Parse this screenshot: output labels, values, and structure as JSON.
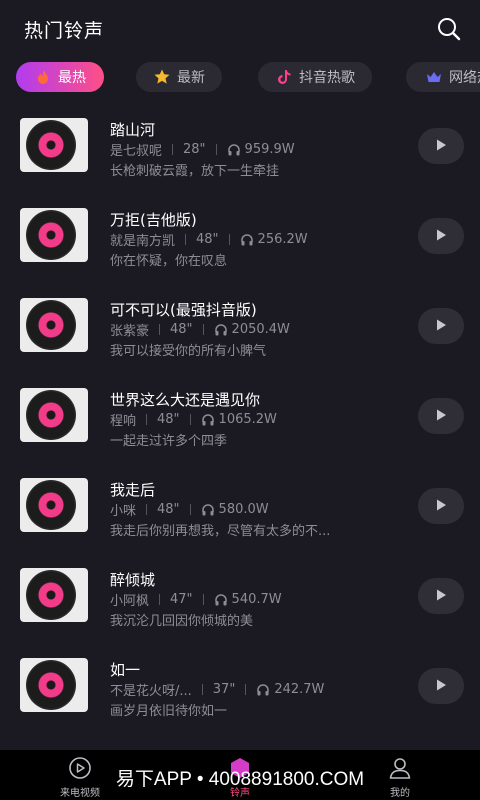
{
  "header": {
    "title": "热门铃声"
  },
  "tabs": [
    {
      "label": "最热",
      "active": true
    },
    {
      "label": "最新",
      "active": false
    },
    {
      "label": "抖音热歌",
      "active": false
    },
    {
      "label": "网络热",
      "active": false
    }
  ],
  "songs": [
    {
      "title": "踏山河",
      "artist": "是七叔呢",
      "duration": "28\"",
      "plays": "959.9W",
      "desc": "长枪刺破云霞，放下一生牵挂"
    },
    {
      "title": "万拒(吉他版)",
      "artist": "就是南方凯",
      "duration": "48\"",
      "plays": "256.2W",
      "desc": "你在怀疑，你在叹息"
    },
    {
      "title": "可不可以(最强抖音版)",
      "artist": "张紫豪",
      "duration": "48\"",
      "plays": "2050.4W",
      "desc": "我可以接受你的所有小脾气"
    },
    {
      "title": "世界这么大还是遇见你",
      "artist": "程响",
      "duration": "48\"",
      "plays": "1065.2W",
      "desc": "一起走过许多个四季"
    },
    {
      "title": "我走后",
      "artist": "小咪",
      "duration": "48\"",
      "plays": "580.0W",
      "desc": "我走后你别再想我，尽管有太多的不..."
    },
    {
      "title": "醉倾城",
      "artist": "小阿枫",
      "duration": "47\"",
      "plays": "540.7W",
      "desc": "我沉沦几回因你倾城的美"
    },
    {
      "title": "如一",
      "artist": "不是花火呀/...",
      "duration": "37\"",
      "plays": "242.7W",
      "desc": "画岁月依旧待你如一"
    }
  ],
  "bottom_nav": [
    {
      "label": "来电视频"
    },
    {
      "label": "铃声"
    },
    {
      "label": "我的"
    }
  ],
  "watermark": "易下APP • 4008891800.COM",
  "colors": {
    "accent_start": "#b13cf0",
    "accent_end": "#ff4f86",
    "background": "#1b1a22"
  }
}
